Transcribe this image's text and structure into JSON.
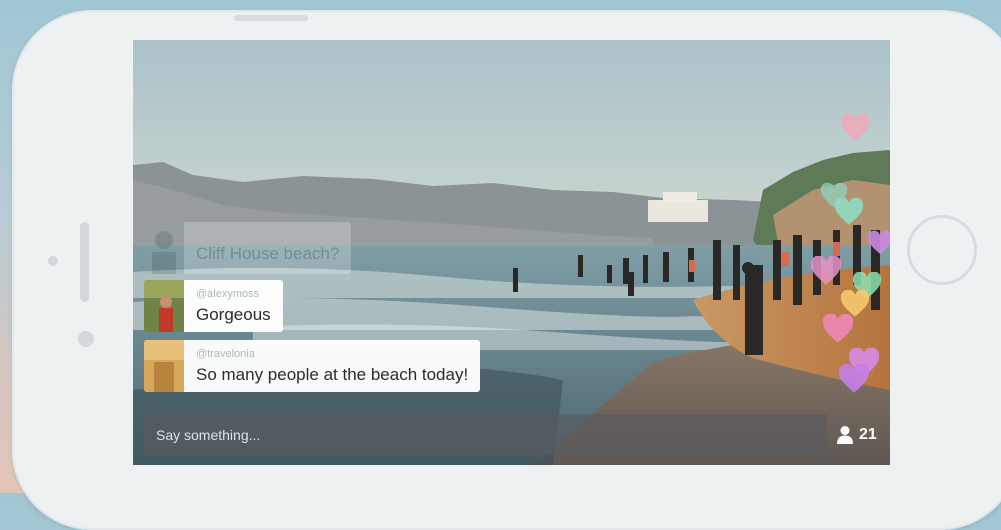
{
  "comments": [
    {
      "username": "",
      "message": "Cliff House beach?"
    },
    {
      "username": "@alexymoss",
      "message": "Gorgeous"
    },
    {
      "username": "@travelonia",
      "message": "So many people at the beach today!"
    }
  ],
  "composer": {
    "placeholder": "Say something..."
  },
  "viewers": {
    "count": "21",
    "icon": "person-icon"
  },
  "colors": {
    "phone_body": "#eef1f2",
    "input_bg": "rgba(90,90,95,0.62)",
    "hearts": [
      "#f1a7b7",
      "#8fd1c0",
      "#c98be0",
      "#ef86b6",
      "#f4c96f",
      "#8be0b0"
    ]
  }
}
